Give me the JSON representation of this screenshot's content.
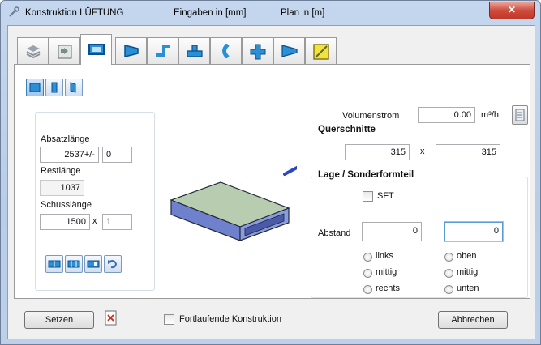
{
  "window": {
    "title_parts": [
      "Konstruktion LÜFTUNG",
      "Eingaben in [mm]",
      "Plan in  [m]"
    ],
    "close_label": "✕"
  },
  "tabs": [
    {
      "icon": "layers-icon",
      "active": false
    },
    {
      "icon": "duct-page-icon",
      "active": false
    },
    {
      "icon": "straight-duct-icon",
      "active": true
    },
    {
      "icon": "transition-icon",
      "active": false
    },
    {
      "icon": "offset-bend-icon",
      "active": false
    },
    {
      "icon": "tee-branch-icon",
      "active": false
    },
    {
      "icon": "bend-icon",
      "active": false
    },
    {
      "icon": "cross-piece-icon",
      "active": false
    },
    {
      "icon": "reducer-icon",
      "active": false
    },
    {
      "icon": "damper-icon",
      "active": false
    }
  ],
  "left": {
    "absatz_label": "Absatzlänge",
    "absatz_value": "2537+/-",
    "absatz_offset": "0",
    "rest_label": "Restlänge",
    "rest_value": "1037",
    "schuss_label": "Schusslänge",
    "schuss_value": "1500",
    "schuss_x": "x",
    "schuss_count": "1"
  },
  "right": {
    "volumen_label": "Volumenstrom",
    "volumen_value": "0.00",
    "volumen_unit": "m³/h",
    "quer_title": "Querschnitte",
    "quer_a": "315",
    "quer_x": "x",
    "quer_b": "315",
    "lage_title": "Lage / Sonderformteil",
    "sft_label": "SFT",
    "abstand_label": "Abstand",
    "abstand_1": "0",
    "abstand_2": "0",
    "radio_left": [
      "links",
      "mittig",
      "rechts"
    ],
    "radio_right": [
      "oben",
      "mittig",
      "unten"
    ]
  },
  "footer": {
    "setzen": "Setzen",
    "fortlaufend": "Fortlaufende Konstruktion",
    "abbrechen": "Abbrechen"
  },
  "colors": {
    "duct_top": "#b8cdb0",
    "duct_front": "#7f8fd6",
    "duct_side": "#5d6fc2",
    "accent": "#3c7fb1"
  }
}
